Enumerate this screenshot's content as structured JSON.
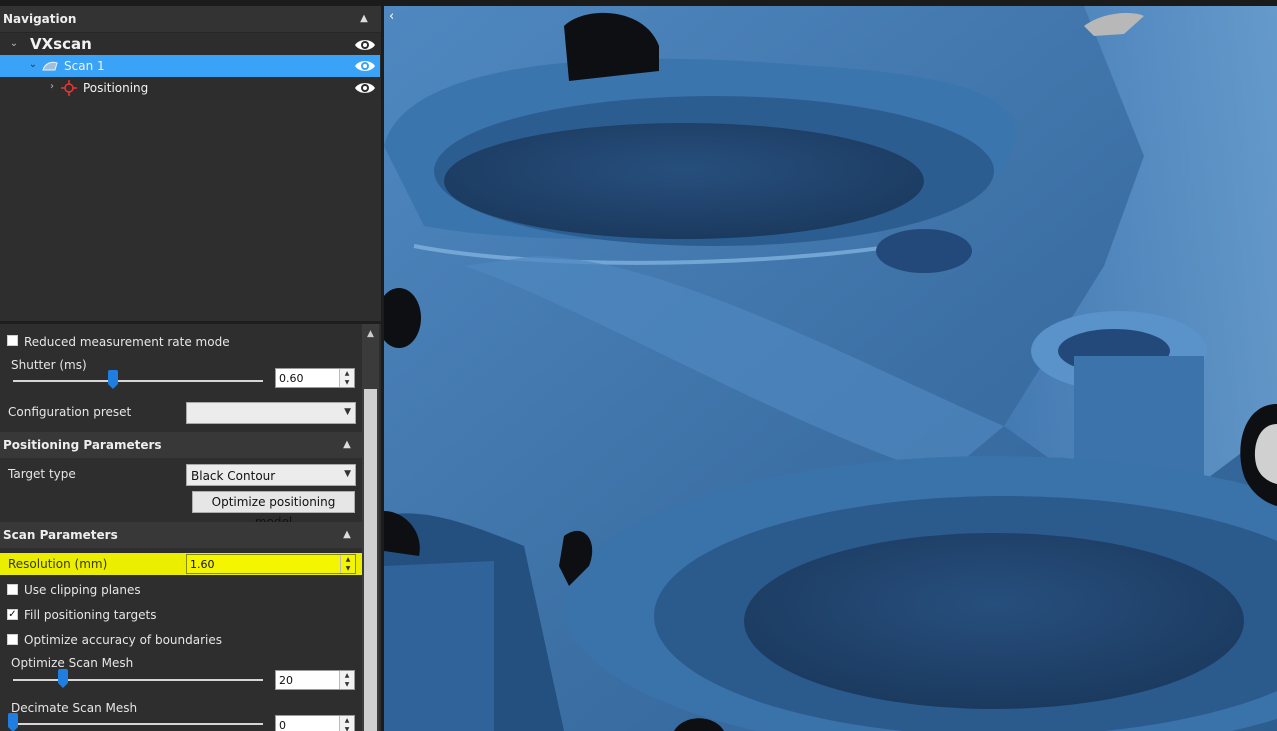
{
  "navigation": {
    "title": "Navigation",
    "tree": [
      {
        "label": "VXscan",
        "level": 0,
        "selected": false
      },
      {
        "label": "Scan 1",
        "level": 1,
        "selected": true
      },
      {
        "label": "Positioning",
        "level": 2,
        "selected": false
      }
    ]
  },
  "scanner_settings": {
    "reduced_rate_label": "Reduced measurement rate mode",
    "reduced_rate_checked": false,
    "shutter_label": "Shutter (ms)",
    "shutter_value": "0.60",
    "shutter_slider_fraction": 0.4,
    "config_preset_label": "Configuration preset",
    "config_preset_value": ""
  },
  "positioning_parameters": {
    "title": "Positioning Parameters",
    "target_type_label": "Target type",
    "target_type_value": "Black Contour",
    "optimize_button": "Optimize positioning model"
  },
  "scan_parameters": {
    "title": "Scan Parameters",
    "resolution_label": "Resolution (mm)",
    "resolution_value": "1.60",
    "use_clipping_label": "Use clipping planes",
    "use_clipping_checked": false,
    "fill_targets_label": "Fill positioning targets",
    "fill_targets_checked": true,
    "optimize_boundaries_label": "Optimize accuracy of boundaries",
    "optimize_boundaries_checked": false,
    "optimize_mesh_label": "Optimize Scan Mesh",
    "optimize_mesh_value": "20",
    "optimize_mesh_slider_fraction": 0.2,
    "decimate_mesh_label": "Decimate Scan Mesh",
    "decimate_mesh_value": "0",
    "decimate_mesh_slider_fraction": 0.0
  },
  "viewport": {
    "collapse_glyph": "‹"
  },
  "colors": {
    "selection": "#3aa3f7",
    "highlight": "#ecee00",
    "slider_accent": "#1f7ee0",
    "mesh_blue": "#3d72a6"
  }
}
